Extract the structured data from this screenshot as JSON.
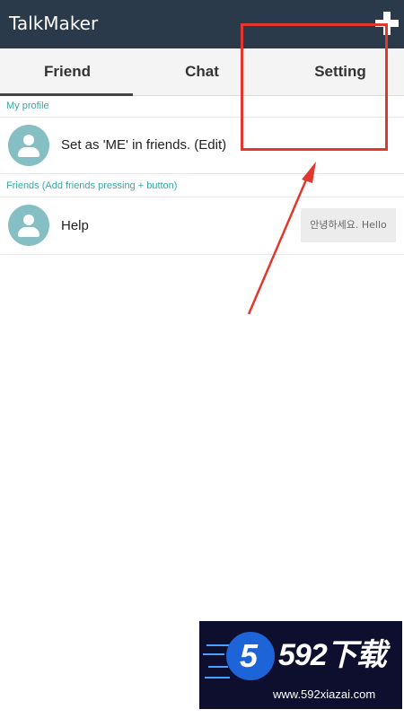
{
  "app": {
    "title": "TalkMaker",
    "add_icon": "plus-icon"
  },
  "tabs": [
    {
      "label": "Friend",
      "active": true
    },
    {
      "label": "Chat",
      "active": false
    },
    {
      "label": "Setting",
      "active": false
    }
  ],
  "profile_section": {
    "label": "My profile",
    "entry": {
      "avatar_icon": "person-icon",
      "text": "Set as 'ME' in friends. (Edit)"
    }
  },
  "friends_section": {
    "label": "Friends (Add friends pressing + button)",
    "entries": [
      {
        "avatar_icon": "person-icon",
        "name": "Help",
        "status": "안녕하세요. Hello"
      }
    ]
  },
  "watermark": {
    "logo_glyph": "5",
    "brand": "592下载",
    "url": "www.592xiazai.com"
  },
  "colors": {
    "app_bar": "#2b3a4a",
    "accent": "#39a7a1",
    "avatar": "#86bfc3",
    "annotation": "#e2372d"
  }
}
